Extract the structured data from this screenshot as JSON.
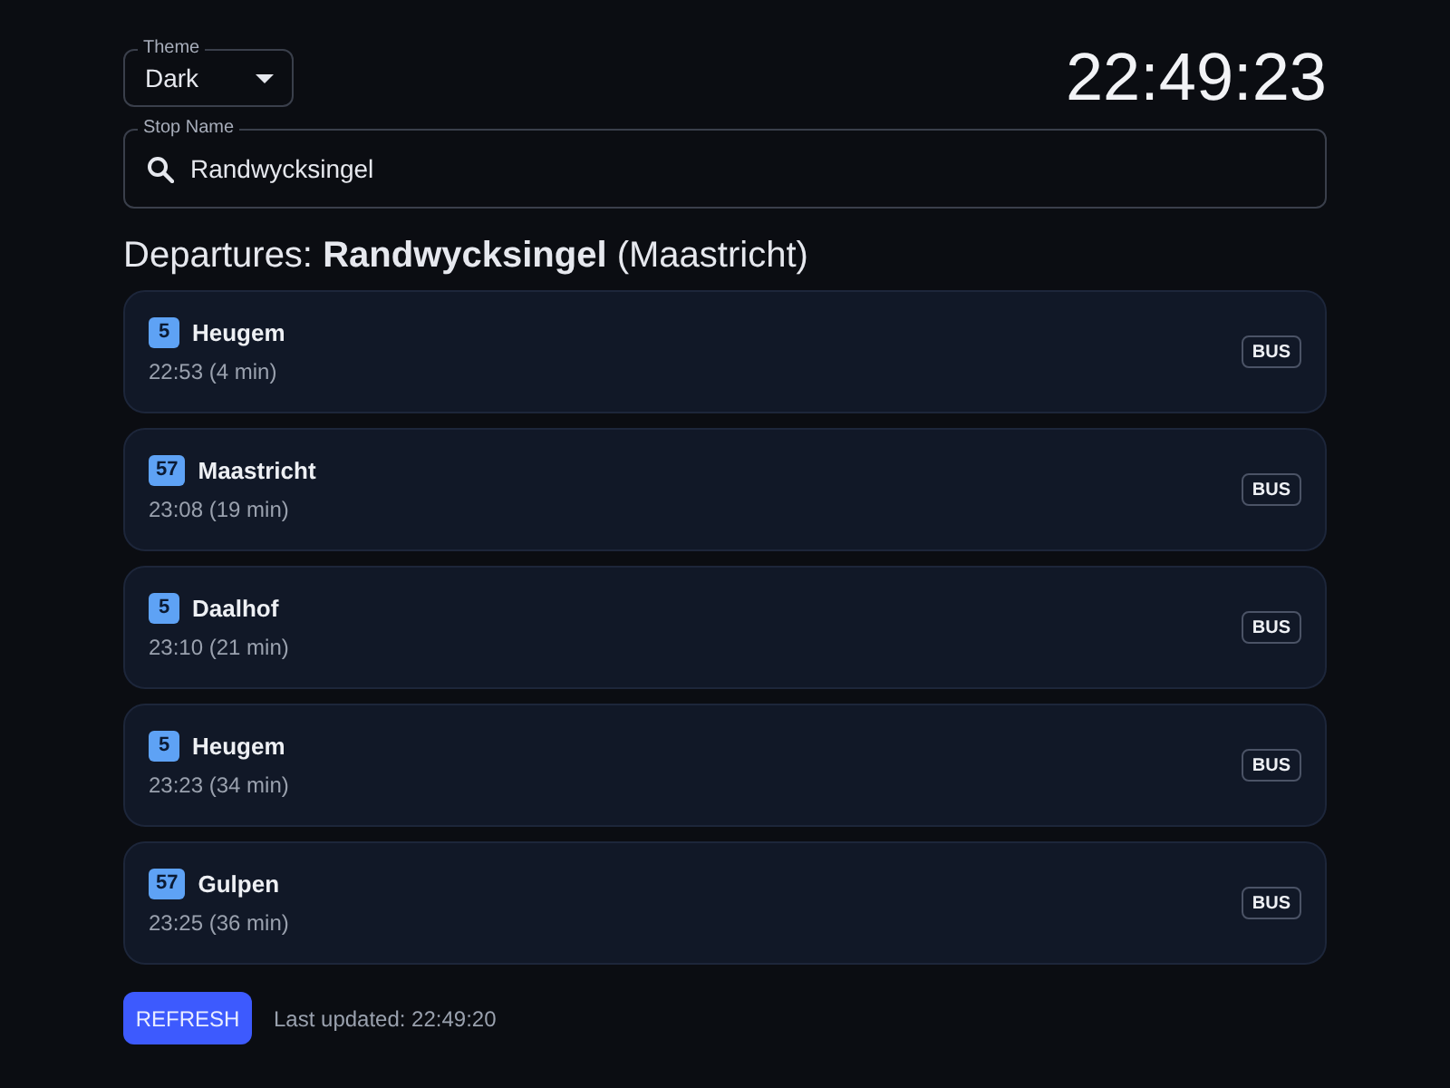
{
  "theme_select": {
    "label": "Theme",
    "value": "Dark"
  },
  "clock": "22:49:23",
  "stop_field": {
    "label": "Stop Name",
    "value": "Randwycksingel"
  },
  "heading": "Departures: **Randwycksingel** (Maastricht)",
  "departures": [
    {
      "route": "5",
      "destination": "Heugem",
      "time": "22:53 (4 min)",
      "mode": "BUS"
    },
    {
      "route": "57",
      "destination": "Maastricht",
      "time": "23:08 (19 min)",
      "mode": "BUS"
    },
    {
      "route": "5",
      "destination": "Daalhof",
      "time": "23:10 (21 min)",
      "mode": "BUS"
    },
    {
      "route": "5",
      "destination": "Heugem",
      "time": "23:23 (34 min)",
      "mode": "BUS"
    },
    {
      "route": "57",
      "destination": "Gulpen",
      "time": "23:25 (36 min)",
      "mode": "BUS"
    }
  ],
  "refresh_button": "REFRESH",
  "last_updated": "Last updated: 22:49:20"
}
